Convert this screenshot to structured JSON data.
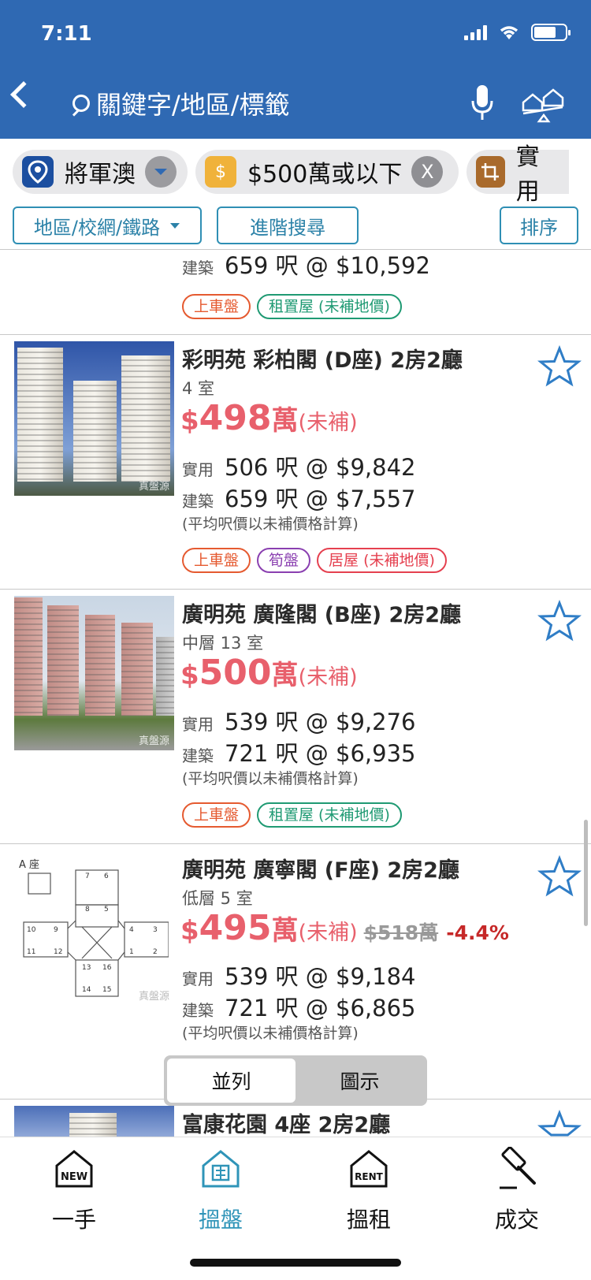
{
  "status_bar": {
    "time": "7:11"
  },
  "header": {
    "search_placeholder": "關鍵字/地區/標籤"
  },
  "chips": [
    {
      "label": "將軍澳"
    },
    {
      "label": "$500萬或以下",
      "close": "X"
    },
    {
      "label": "實用"
    }
  ],
  "filters": {
    "area": "地區/校網/鐵路",
    "advanced": "進階搜尋",
    "sort": "排序"
  },
  "listings": [
    {
      "gross_label": "建築",
      "gross": "659 呎 @ $10,592",
      "tags": [
        "上車盤",
        "租置屋 (未補地價)"
      ]
    },
    {
      "title": "彩明苑 彩柏閣 (D座) 2房2廳",
      "unit": "4 室",
      "price_num": "498",
      "price_unit": "萬",
      "price_note": "(未補)",
      "saleable_label": "實用",
      "saleable": "506 呎 @ $9,842",
      "gross_label": "建築",
      "gross": "659 呎 @ $7,557",
      "note": "(平均呎價以未補價格計算)",
      "tags": [
        "上車盤",
        "筍盤",
        "居屋 (未補地價)"
      ]
    },
    {
      "title": "廣明苑 廣隆閣 (B座) 2房2廳",
      "unit": "中層 13 室",
      "price_num": "500",
      "price_unit": "萬",
      "price_note": "(未補)",
      "saleable_label": "實用",
      "saleable": "539 呎 @ $9,276",
      "gross_label": "建築",
      "gross": "721 呎 @ $6,935",
      "note": "(平均呎價以未補價格計算)",
      "tags": [
        "上車盤",
        "租置屋 (未補地價)"
      ]
    },
    {
      "title": "廣明苑 廣寧閣 (F座) 2房2廳",
      "unit": "低層 5 室",
      "price_num": "495",
      "price_unit": "萬",
      "price_note": "(未補)",
      "old_price": "$518萬",
      "change": "-4.4%",
      "saleable_label": "實用",
      "saleable": "539 呎 @ $9,184",
      "gross_label": "建築",
      "gross": "721 呎 @ $6,865",
      "note": "(平均呎價以未補價格計算)",
      "floorplan_label": "A 座"
    },
    {
      "title": "富康花園 4座 2房2廳"
    }
  ],
  "view_toggle": {
    "list": "並列",
    "map": "圖示"
  },
  "tabbar": [
    {
      "label": "一手",
      "icon_text": "NEW"
    },
    {
      "label": "搵盤"
    },
    {
      "label": "搵租",
      "icon_text": "RENT"
    },
    {
      "label": "成交"
    }
  ],
  "watermark": "真盤源",
  "colors": {
    "header": "#2f69b3",
    "price": "#e8606c",
    "accent": "#2f94b8"
  }
}
